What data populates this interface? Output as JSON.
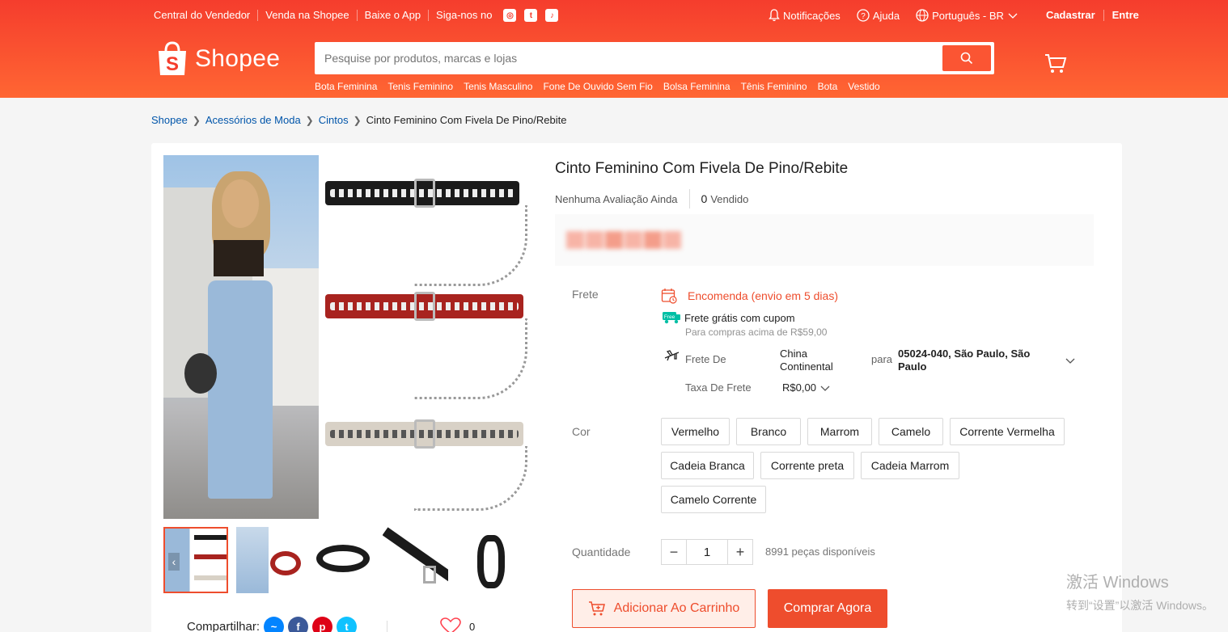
{
  "topbar": {
    "links": [
      "Central do Vendedor",
      "Venda na Shopee",
      "Baixe o App",
      "Siga-nos no"
    ],
    "notifications": "Notificações",
    "help": "Ajuda",
    "language": "Português - BR",
    "signup": "Cadastrar",
    "login": "Entre"
  },
  "header": {
    "logo": "Shopee",
    "search_placeholder": "Pesquise por produtos, marcas e lojas",
    "suggestions": [
      "Bota Feminina",
      "Tenis Feminino",
      "Tenis Masculino",
      "Fone De Ouvido Sem Fio",
      "Bolsa Feminina",
      "Tênis Feminino",
      "Bota",
      "Vestido"
    ]
  },
  "breadcrumb": [
    "Shopee",
    "Acessórios de Moda",
    "Cintos",
    "Cinto Feminino Com Fivela De Pino/Rebite"
  ],
  "product": {
    "title": "Cinto Feminino Com Fivela De Pino/Rebite",
    "rating_text": "Nenhuma Avaliação Ainda",
    "sold_count": "0",
    "sold_label": "Vendido"
  },
  "shipping": {
    "label": "Frete",
    "order_text": "Encomenda (envio em 5 dias)",
    "free_badge": "Free",
    "free_text": "Frete grátis com cupom",
    "free_note": "Para compras acima de R$59,00",
    "from_label": "Frete De",
    "from_value": "China Continental",
    "to_label": "para",
    "to_value": "05024-040, São Paulo, São Paulo",
    "fee_label": "Taxa De Frete",
    "fee_value": "R$0,00"
  },
  "colors": {
    "label": "Cor",
    "options": [
      "Vermelho",
      "Branco",
      "Marrom",
      "Camelo",
      "Corrente Vermelha",
      "Cadeia Branca",
      "Corrente preta",
      "Cadeia Marrom",
      "Camelo Corrente"
    ]
  },
  "quantity": {
    "label": "Quantidade",
    "value": "1",
    "available": "8991 peças disponíveis"
  },
  "actions": {
    "add_to_cart": "Adicionar Ao Carrinho",
    "buy_now": "Comprar Agora"
  },
  "share": {
    "label": "Compartilhar:",
    "favorites": "0"
  },
  "watermark": {
    "line1": "激活 Windows",
    "line2": "转到“设置”以激活 Windows。"
  },
  "theme": {
    "brand": "#ee4d2d",
    "link": "#0055aa"
  }
}
